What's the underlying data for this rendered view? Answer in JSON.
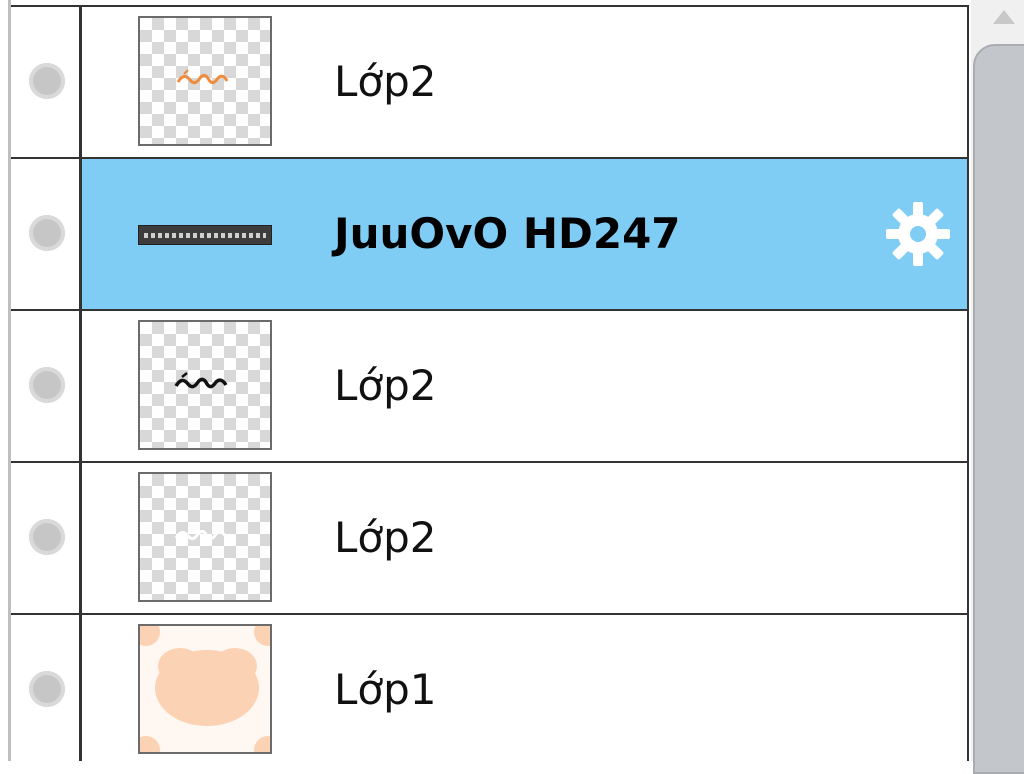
{
  "layers": [
    {
      "name": "Lớp2",
      "selected": false,
      "thumb_icon": "orange-text-thumbnail"
    },
    {
      "name": "JuuOvO HD247",
      "selected": true,
      "thumb_icon": "text-layer-thumbnail",
      "settings_icon": "gear-icon"
    },
    {
      "name": "Lớp2",
      "selected": false,
      "thumb_icon": "black-text-thumbnail"
    },
    {
      "name": "Lớp2",
      "selected": false,
      "thumb_icon": "white-text-thumbnail"
    },
    {
      "name": "Lớp1",
      "selected": false,
      "thumb_icon": "peach-blob-thumbnail"
    }
  ],
  "colors": {
    "selected_row": "#7fcdf5",
    "border": "#333333",
    "gear": "#ffffff",
    "visibility_dot": "#c6c6c6"
  }
}
